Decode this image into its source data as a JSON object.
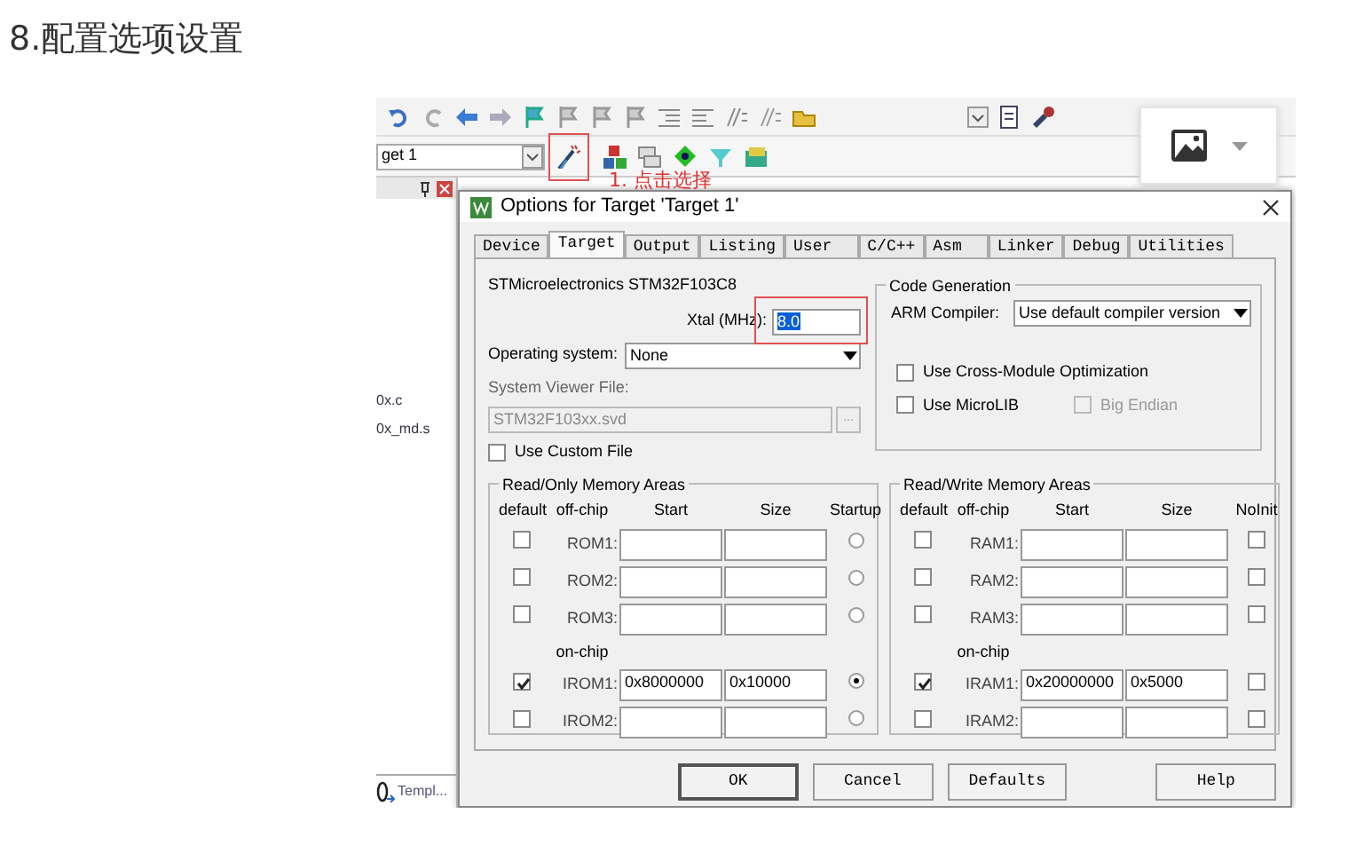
{
  "heading": "8.配置选项设置",
  "ide": {
    "target_select": "get 1",
    "files": [
      "0x.c",
      "0x_md.s"
    ],
    "bottom_tab": "Templ..."
  },
  "annotation": "1. 点击选择",
  "dialog": {
    "title": "Options for Target 'Target 1'",
    "tabs": [
      {
        "label": "Device",
        "selected": false
      },
      {
        "label": "Target",
        "selected": true
      },
      {
        "label": "Output",
        "selected": false
      },
      {
        "label": "Listing",
        "selected": false
      },
      {
        "label": "User",
        "selected": false
      },
      {
        "label": "C/C++",
        "selected": false
      },
      {
        "label": "Asm",
        "selected": false
      },
      {
        "label": "Linker",
        "selected": false
      },
      {
        "label": "Debug",
        "selected": false
      },
      {
        "label": "Utilities",
        "selected": false
      }
    ],
    "device": "STMicroelectronics STM32F103C8",
    "xtal": {
      "label": "Xtal (MHz):",
      "value": "8.0"
    },
    "os": {
      "label": "Operating system:",
      "value": "None"
    },
    "system_viewer": {
      "label": "System Viewer File:",
      "value": "STM32F103xx.svd",
      "browse": "...",
      "disabled": true
    },
    "custom_file": {
      "label": "Use Custom File",
      "checked": false
    },
    "code_gen": {
      "title": "Code Generation",
      "compiler_label": "ARM Compiler:",
      "compiler_value": "Use default compiler version",
      "options": [
        {
          "label": "Use Cross-Module Optimization",
          "checked": false,
          "disabled": false
        },
        {
          "label": "Use MicroLIB",
          "checked": false,
          "disabled": false
        },
        {
          "label": "Big Endian",
          "checked": false,
          "disabled": true
        }
      ]
    },
    "rom": {
      "title": "Read/Only Memory Areas",
      "columns": [
        "default",
        "off-chip",
        "Start",
        "Size",
        "Startup"
      ],
      "onchip_label": "on-chip",
      "rows": [
        {
          "name": "ROM1:",
          "default": false,
          "selected": false
        },
        {
          "name": "ROM2:",
          "default": false,
          "selected": false
        },
        {
          "name": "ROM3:",
          "default": false,
          "selected": false
        },
        {
          "name": "IROM1:",
          "default": true,
          "start": "0x8000000",
          "size": "0x10000",
          "selected": true
        },
        {
          "name": "IROM2:",
          "default": false,
          "selected": false
        }
      ]
    },
    "ram": {
      "title": "Read/Write Memory Areas",
      "columns": [
        "default",
        "off-chip",
        "Start",
        "Size",
        "NoInit"
      ],
      "onchip_label": "on-chip",
      "rows": [
        {
          "name": "RAM1:",
          "default": false,
          "no_init": false
        },
        {
          "name": "RAM2:",
          "default": false,
          "no_init": false
        },
        {
          "name": "RAM3:",
          "default": false,
          "no_init": false
        },
        {
          "name": "IRAM1:",
          "default": true,
          "start": "0x20000000",
          "size": "0x5000",
          "no_init": false
        },
        {
          "name": "IRAM2:",
          "default": false,
          "no_init": false
        }
      ]
    },
    "buttons": [
      {
        "label": "OK",
        "default": true
      },
      {
        "label": "Cancel",
        "default": false
      },
      {
        "label": "Defaults",
        "default": false
      },
      {
        "label": "Help",
        "default": false
      }
    ]
  }
}
